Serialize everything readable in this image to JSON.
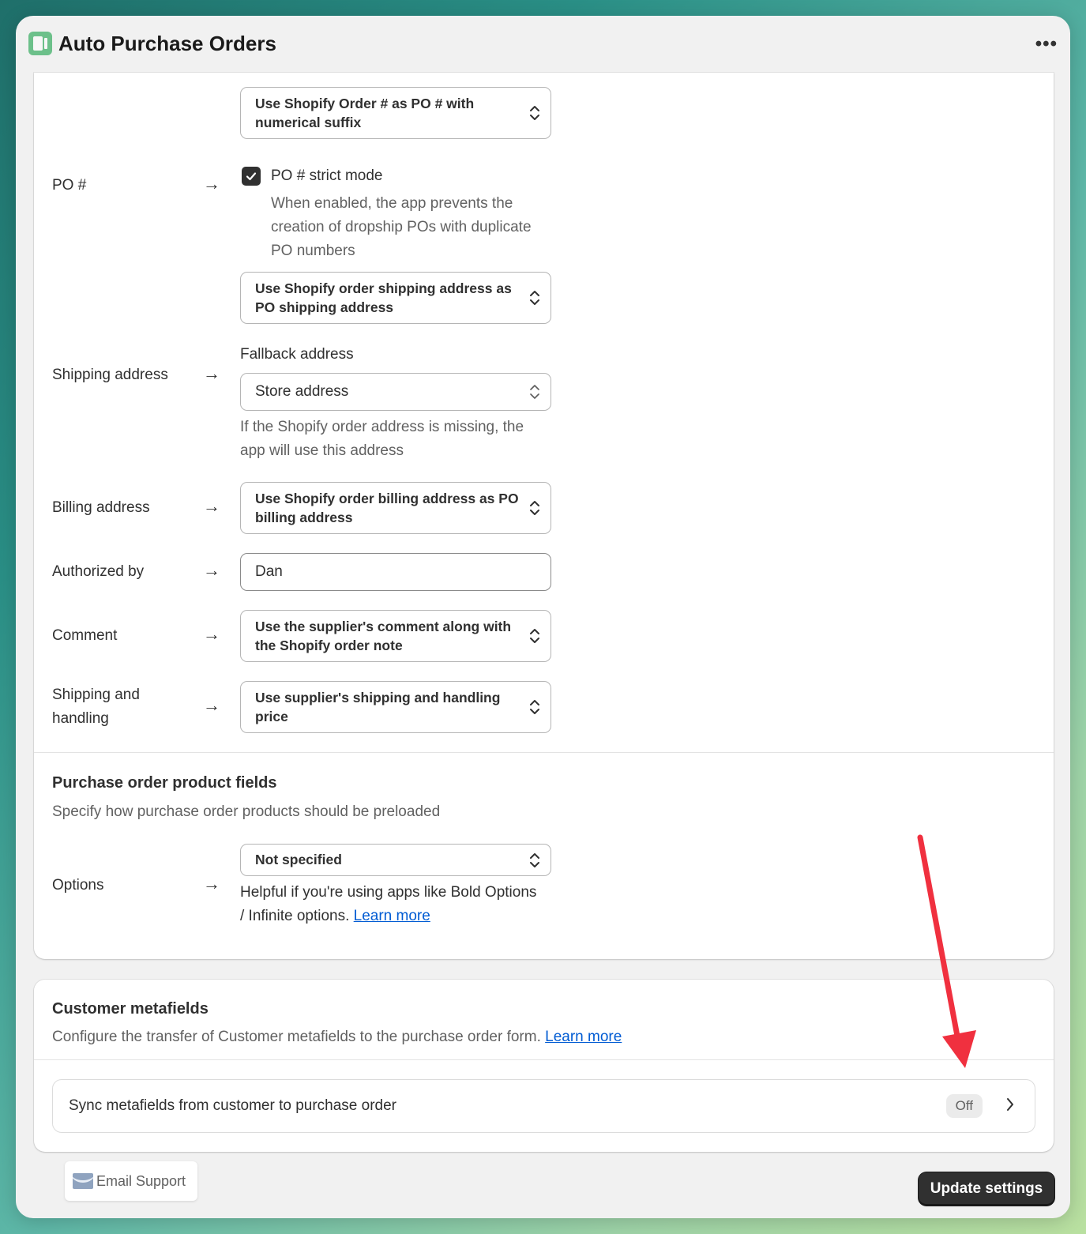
{
  "header": {
    "title": "Auto Purchase Orders",
    "more_label": "•••"
  },
  "po_fields": {
    "po_number": {
      "label": "PO #",
      "select_value": "Use Shopify Order # as PO # with numerical suffix",
      "strict_mode_label": "PO # strict mode",
      "strict_mode_checked": true,
      "strict_mode_help": "When enabled, the app prevents the creation of dropship POs with duplicate PO numbers"
    },
    "shipping_address": {
      "label": "Shipping address",
      "select_value": "Use Shopify order shipping address as PO shipping address",
      "fallback_label": "Fallback address",
      "fallback_value": "Store address",
      "fallback_help": "If the Shopify order address is missing, the app will use this address"
    },
    "billing_address": {
      "label": "Billing address",
      "select_value": "Use Shopify order billing address as PO billing address"
    },
    "authorized_by": {
      "label": "Authorized by",
      "value": "Dan"
    },
    "comment": {
      "label": "Comment",
      "select_value": "Use the supplier's comment along with the Shopify order note"
    },
    "shipping_handling": {
      "label": "Shipping and handling",
      "select_value": "Use supplier's shipping and handling price"
    }
  },
  "product_fields": {
    "title": "Purchase order product fields",
    "description": "Specify how purchase order products should be preloaded",
    "options": {
      "label": "Options",
      "select_value": "Not specified",
      "help": "Helpful if you're using apps like Bold Options / Infinite options.",
      "learn_more": "Learn more"
    }
  },
  "customer_metafields": {
    "title": "Customer metafields",
    "description": "Configure the transfer of Customer metafields to the purchase order form.",
    "learn_more": "Learn more",
    "sync_label": "Sync metafields from customer to purchase order",
    "sync_status": "Off"
  },
  "footer": {
    "email_support": "Email Support",
    "update_button": "Update settings"
  },
  "colors": {
    "primary_button": "#303030",
    "link": "#005bd3",
    "annotation_arrow": "#f0303f"
  }
}
